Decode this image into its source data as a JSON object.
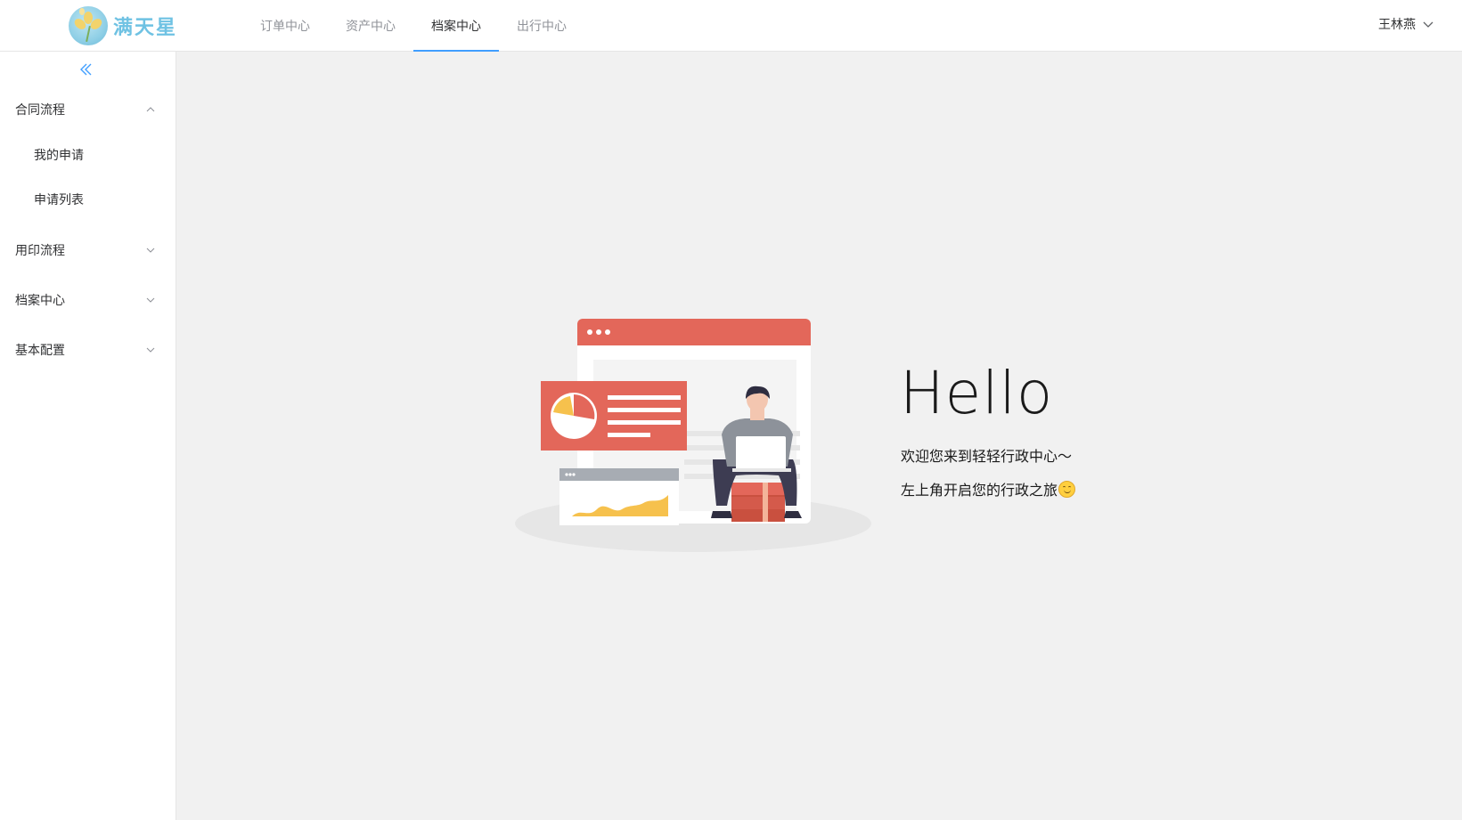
{
  "brand": {
    "name": "满天星",
    "accent": "#6fc2e3"
  },
  "topnav": {
    "tabs": [
      {
        "label": "订单中心",
        "active": false
      },
      {
        "label": "资产中心",
        "active": false
      },
      {
        "label": "档案中心",
        "active": true
      },
      {
        "label": "出行中心",
        "active": false
      }
    ],
    "active_color": "#409eff"
  },
  "user": {
    "name": "王林燕",
    "icon": "chevron-down-icon"
  },
  "sidebar": {
    "collapse_icon": "double-chevron-left-icon",
    "groups": [
      {
        "label": "合同流程",
        "expanded": true,
        "items": [
          "我的申请",
          "申请列表"
        ]
      },
      {
        "label": "用印流程",
        "expanded": false,
        "items": []
      },
      {
        "label": "档案中心",
        "expanded": false,
        "items": []
      },
      {
        "label": "基本配置",
        "expanded": false,
        "items": []
      }
    ]
  },
  "main": {
    "greeting": "Hello",
    "welcome_line1": "欢迎您来到轻轻行政中心～",
    "welcome_line2": "左上角开启您的行政之旅",
    "emoji": "smiling-face-icon"
  }
}
